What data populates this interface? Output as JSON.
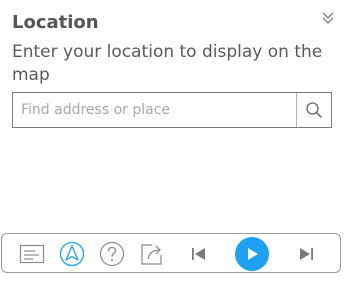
{
  "panel": {
    "title": "Location",
    "description": "Enter your location to display on the map",
    "collapse_icon": "double-chevron-down-icon"
  },
  "search": {
    "placeholder": "Find address or place",
    "value": "",
    "button_icon": "search-icon"
  },
  "toolbar": {
    "tools": [
      {
        "name": "details",
        "icon": "list-panel-icon"
      },
      {
        "name": "location",
        "icon": "navigation-arrow-icon",
        "active": true
      },
      {
        "name": "help",
        "icon": "question-circle-icon"
      },
      {
        "name": "share",
        "icon": "share-icon"
      },
      {
        "name": "previous",
        "icon": "skip-previous-icon"
      },
      {
        "name": "play",
        "icon": "play-icon"
      },
      {
        "name": "next",
        "icon": "skip-next-icon"
      }
    ]
  },
  "colors": {
    "accent": "#1ea1f2",
    "text": "#555555",
    "icon": "#8a8a8a",
    "border": "#9a9a9a"
  }
}
